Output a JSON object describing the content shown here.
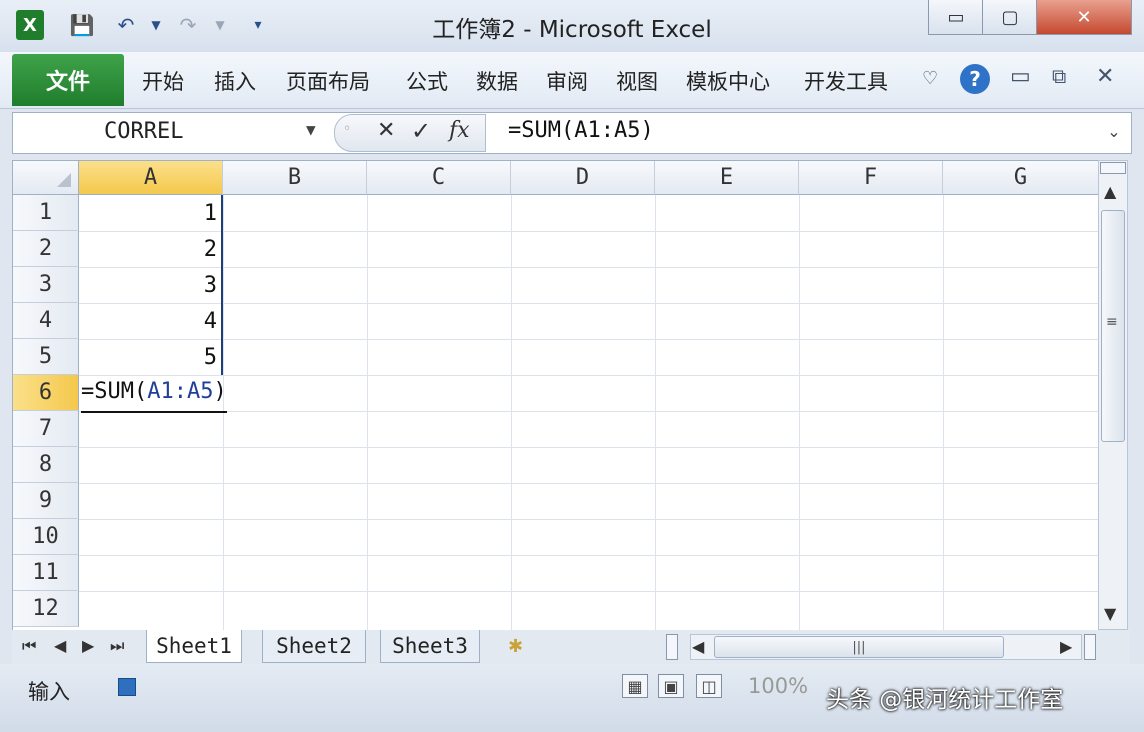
{
  "window": {
    "title": "工作簿2 - Microsoft Excel"
  },
  "ribbon": {
    "file_tab": "文件",
    "tabs": [
      "开始",
      "插入",
      "页面布局",
      "公式",
      "数据",
      "审阅",
      "视图",
      "模板中心",
      "开发工具"
    ]
  },
  "formula_bar": {
    "name_box": "CORREL",
    "cancel": "✕",
    "enter": "✓",
    "fx": "fx",
    "formula": "=SUM(A1:A5)"
  },
  "grid": {
    "columns": [
      "A",
      "B",
      "C",
      "D",
      "E",
      "F",
      "G"
    ],
    "rows": [
      "1",
      "2",
      "3",
      "4",
      "5",
      "6",
      "7",
      "8",
      "9",
      "10",
      "11",
      "12"
    ],
    "a_values": [
      "1",
      "2",
      "3",
      "4",
      "5"
    ],
    "editing_cell": {
      "prefix": "=SUM(",
      "ref": "A1:A5",
      "suffix": ")"
    }
  },
  "sheets": [
    "Sheet1",
    "Sheet2",
    "Sheet3"
  ],
  "status": {
    "mode": "输入",
    "zoom": "100%"
  },
  "watermark": "头条 @银河统计工作室",
  "icons": {
    "app": "excel-logo-icon",
    "save": "save-icon",
    "undo": "undo-icon",
    "redo": "redo-icon",
    "help": "help-icon"
  }
}
